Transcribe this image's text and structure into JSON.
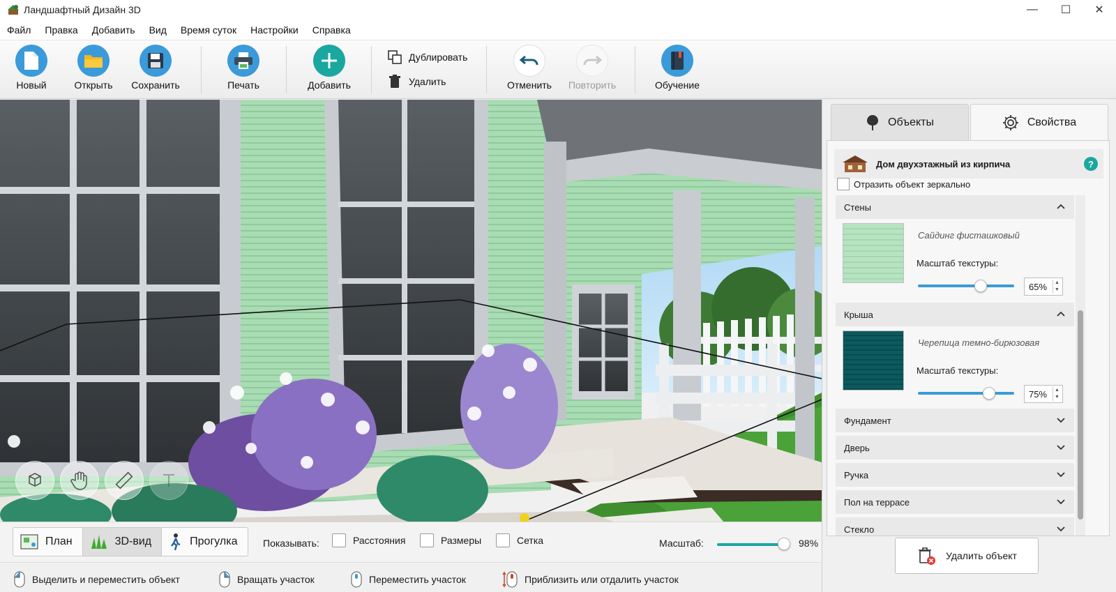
{
  "window": {
    "title": "Ландшафтный Дизайн 3D",
    "controls": [
      "—",
      "☐",
      "✕"
    ]
  },
  "menu": [
    "Файл",
    "Правка",
    "Добавить",
    "Вид",
    "Время суток",
    "Настройки",
    "Справка"
  ],
  "toolbar": {
    "new": "Новый",
    "open": "Открыть",
    "save": "Сохранить",
    "print": "Печать",
    "add": "Добавить",
    "duplicate": "Дублировать",
    "delete": "Удалить",
    "undo": "Отменить",
    "redo": "Повторить",
    "tutorial": "Обучение"
  },
  "view_tabs": [
    "План",
    "3D-вид",
    "Прогулка"
  ],
  "active_view_tab": "3D-вид",
  "show": {
    "label": "Показывать:",
    "options": [
      "Расстояния",
      "Размеры",
      "Сетка"
    ]
  },
  "zoom": {
    "label": "Масштаб:",
    "value": "98%"
  },
  "status_hints": [
    "Выделить и переместить объект",
    "Вращать участок",
    "Переместить участок",
    "Приблизить или отдалить участок"
  ],
  "panel": {
    "tabs": [
      "Объекты",
      "Свойства"
    ],
    "active_tab": "Свойства",
    "object_name": "Дом двухэтажный из кирпича",
    "help": "?",
    "mirror_label": "Отразить объект зеркально",
    "walls": {
      "title": "Стены",
      "material": "Сайдинг фисташковый",
      "scale_label": "Масштаб текстуры:",
      "scale_value": "65%",
      "color": "#b7e3c1"
    },
    "roof": {
      "title": "Крыша",
      "material": "Черепица темно-бирюзовая",
      "scale_label": "Масштаб текстуры:",
      "scale_value": "75%",
      "color": "#0b5a5e"
    },
    "sections": [
      "Фундамент",
      "Дверь",
      "Ручка",
      "Пол на террасе",
      "Стекло"
    ],
    "delete_button": "Удалить объект"
  },
  "colors": {
    "accent": "#1aa7a0",
    "slider": "#3a9bd8",
    "siding": "#a8dcb2"
  }
}
